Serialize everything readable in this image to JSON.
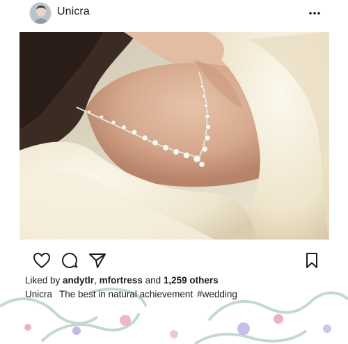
{
  "post": {
    "username": "Unicra",
    "liked_prefix": "Liked by ",
    "liked_user_1": "andytlr",
    "liked_sep": ", ",
    "liked_user_2": "mfortress",
    "liked_and": " and ",
    "liked_count": "1,259 others",
    "caption_author": "Unicra",
    "caption_text": "The best in natural achievement",
    "caption_tag": "#wedding"
  },
  "icons": {
    "more": "more-horizontal-icon",
    "like": "heart-icon",
    "comment": "comment-icon",
    "share": "paper-plane-icon",
    "save": "bookmark-icon"
  },
  "colors": {
    "text": "#1b1b1b",
    "fur": "#f3ecd9",
    "skin": "#d9b097",
    "hair": "#3a2a22"
  }
}
